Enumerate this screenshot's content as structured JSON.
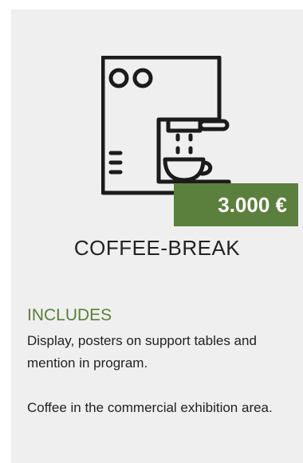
{
  "card": {
    "icon": "coffee-machine-icon",
    "price": "3.000 €",
    "title": "COFFEE-BREAK",
    "includes_heading": "INCLUDES",
    "paragraphs": [
      "Display, posters on support tables and mention in program.",
      "Coffee in the commercial exhibition area."
    ]
  },
  "colors": {
    "accent": "#5b7f3c",
    "card_background": "#efefef",
    "text": "#222222"
  }
}
